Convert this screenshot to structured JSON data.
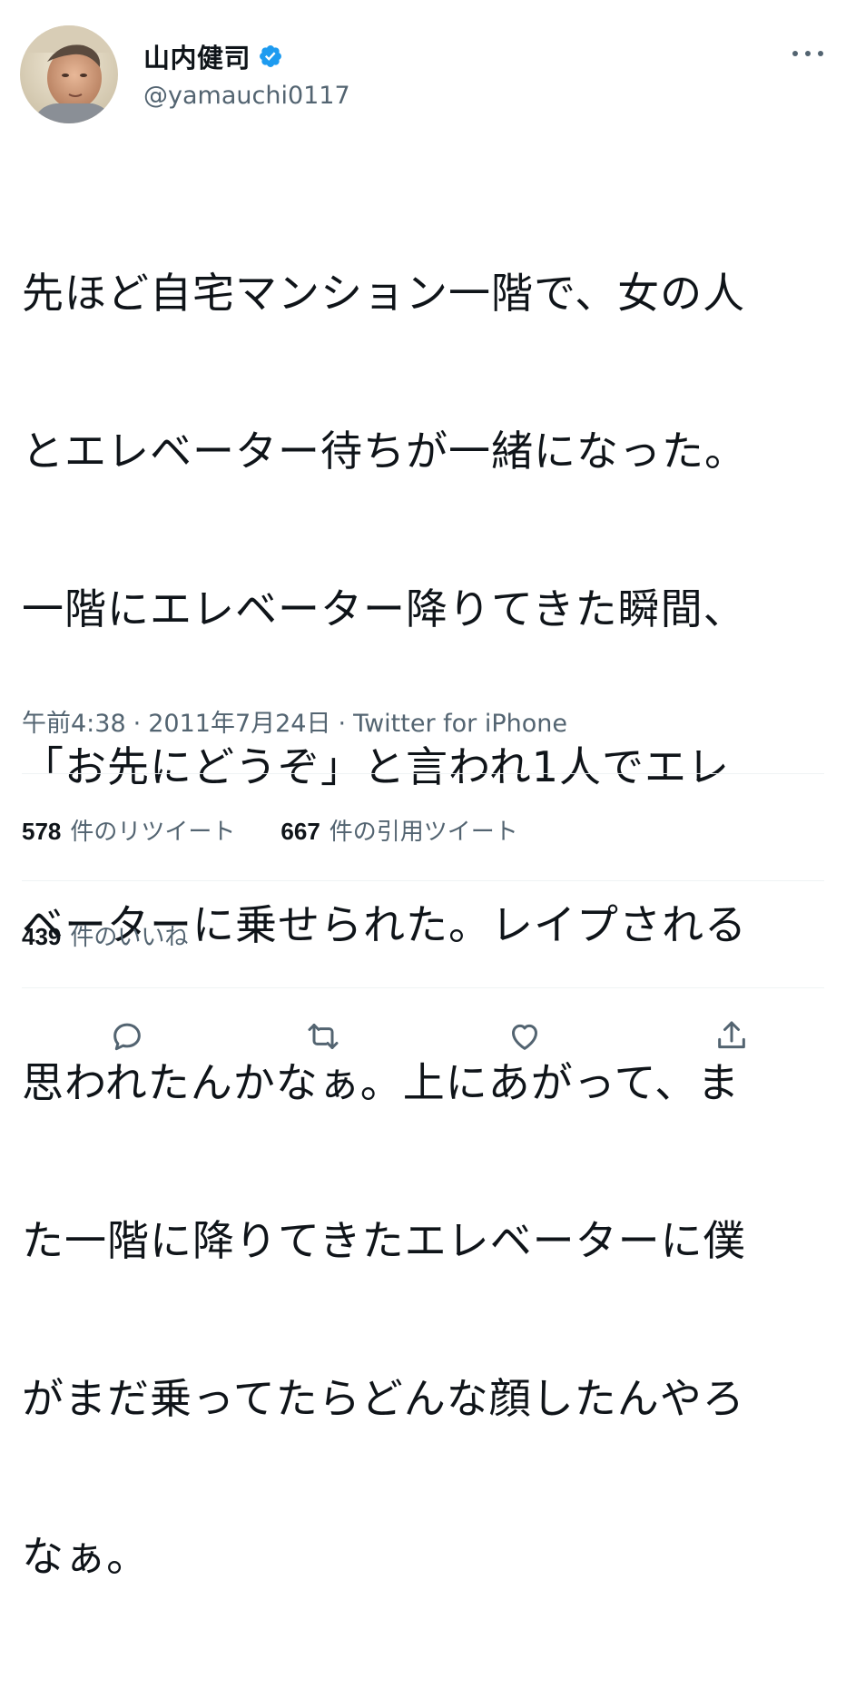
{
  "author": {
    "name": "山内健司",
    "handle": "@yamauchi0117",
    "verified": true
  },
  "tweet": {
    "text_lines": [
      "先ほど自宅マンション一階で、女の人",
      "とエレベーター待ちが一緒になった。",
      "一階にエレベーター降りてきた瞬間、",
      "「お先にどうぞ」と言われ1人でエレ",
      "ベーターに乗せられた。レイプされる",
      "思われたんかなぁ。上にあがって、ま",
      "た一階に降りてきたエレベーターに僕",
      "がまだ乗ってたらどんな顔したんやろ",
      "なぁ。"
    ]
  },
  "meta": {
    "time": "午前4:38",
    "date": "2011年7月24日",
    "separator": "·",
    "source": "Twitter for iPhone"
  },
  "stats": {
    "retweets_count": "578",
    "retweets_label": "件のリツイート",
    "quotes_count": "667",
    "quotes_label": "件の引用ツイート",
    "likes_count": "439",
    "likes_label": "件のいいね"
  },
  "colors": {
    "text": "#0f1419",
    "secondary": "#536471",
    "divider": "#eff3f4",
    "verified": "#1d9bf0"
  },
  "icons": {
    "reply": "reply-icon",
    "retweet": "retweet-icon",
    "like": "heart-icon",
    "share": "share-icon",
    "more": "more-icon",
    "verified": "verified-badge-icon"
  }
}
